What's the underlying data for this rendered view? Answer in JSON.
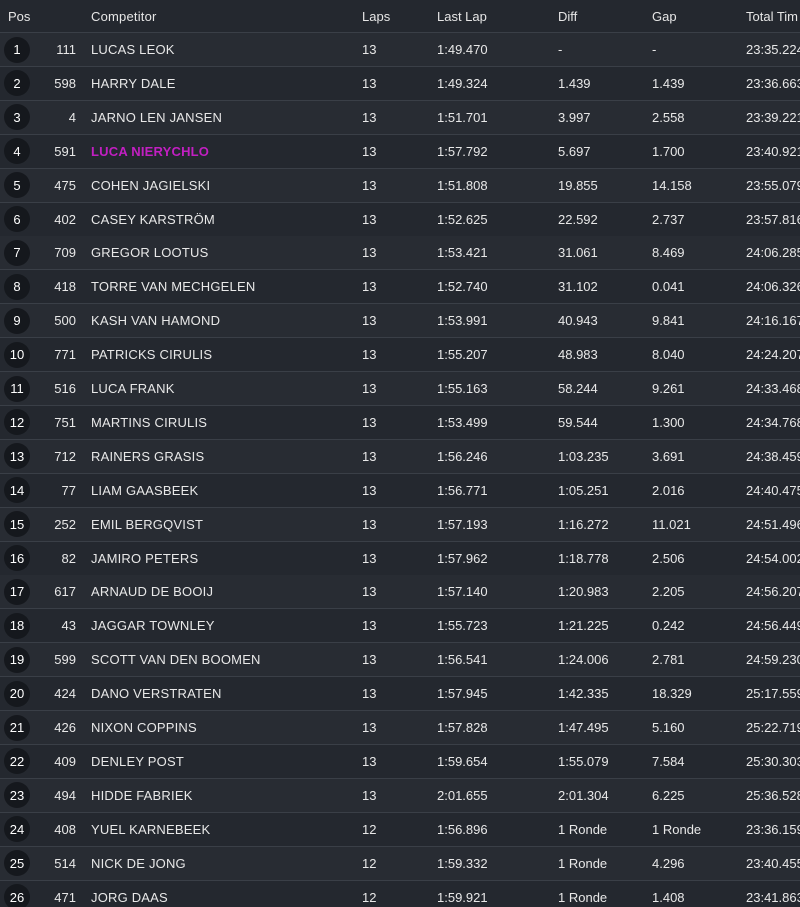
{
  "header": {
    "pos": "Pos",
    "competitor": "Competitor",
    "laps": "Laps",
    "last_lap": "Last Lap",
    "diff": "Diff",
    "gap": "Gap",
    "total_time": "Total Tim"
  },
  "colors": {
    "background": "#24282f",
    "row_alt": "#282c33",
    "highlight_name": "#c21fc2",
    "position_circle": "#15181d"
  },
  "rows": [
    {
      "pos": "1",
      "number": "111",
      "name": "LUCAS LEOK",
      "laps": "13",
      "last_lap": "1:49.470",
      "diff": "-",
      "gap": "-",
      "total": "23:35.224"
    },
    {
      "pos": "2",
      "number": "598",
      "name": "HARRY DALE",
      "laps": "13",
      "last_lap": "1:49.324",
      "diff": "1.439",
      "gap": "1.439",
      "total": "23:36.663"
    },
    {
      "pos": "3",
      "number": "4",
      "name": "JARNO LEN JANSEN",
      "laps": "13",
      "last_lap": "1:51.701",
      "diff": "3.997",
      "gap": "2.558",
      "total": "23:39.221"
    },
    {
      "pos": "4",
      "number": "591",
      "name": "LUCA NIERYCHLO",
      "laps": "13",
      "last_lap": "1:57.792",
      "diff": "5.697",
      "gap": "1.700",
      "total": "23:40.921",
      "highlight": true
    },
    {
      "pos": "5",
      "number": "475",
      "name": "COHEN JAGIELSKI",
      "laps": "13",
      "last_lap": "1:51.808",
      "diff": "19.855",
      "gap": "14.158",
      "total": "23:55.079"
    },
    {
      "pos": "6",
      "number": "402",
      "name": "CASEY KARSTRÖM",
      "laps": "13",
      "last_lap": "1:52.625",
      "diff": "22.592",
      "gap": "2.737",
      "total": "23:57.816"
    },
    {
      "pos": "7",
      "number": "709",
      "name": "GREGOR LOOTUS",
      "laps": "13",
      "last_lap": "1:53.421",
      "diff": "31.061",
      "gap": "8.469",
      "total": "24:06.285"
    },
    {
      "pos": "8",
      "number": "418",
      "name": "TORRE VAN MECHGELEN",
      "laps": "13",
      "last_lap": "1:52.740",
      "diff": "31.102",
      "gap": "0.041",
      "total": "24:06.326"
    },
    {
      "pos": "9",
      "number": "500",
      "name": "KASH VAN HAMOND",
      "laps": "13",
      "last_lap": "1:53.991",
      "diff": "40.943",
      "gap": "9.841",
      "total": "24:16.167"
    },
    {
      "pos": "10",
      "number": "771",
      "name": "PATRICKS CIRULIS",
      "laps": "13",
      "last_lap": "1:55.207",
      "diff": "48.983",
      "gap": "8.040",
      "total": "24:24.207"
    },
    {
      "pos": "11",
      "number": "516",
      "name": "LUCA FRANK",
      "laps": "13",
      "last_lap": "1:55.163",
      "diff": "58.244",
      "gap": "9.261",
      "total": "24:33.468"
    },
    {
      "pos": "12",
      "number": "751",
      "name": "MARTINS CIRULIS",
      "laps": "13",
      "last_lap": "1:53.499",
      "diff": "59.544",
      "gap": "1.300",
      "total": "24:34.768"
    },
    {
      "pos": "13",
      "number": "712",
      "name": "RAINERS GRASIS",
      "laps": "13",
      "last_lap": "1:56.246",
      "diff": "1:03.235",
      "gap": "3.691",
      "total": "24:38.459"
    },
    {
      "pos": "14",
      "number": "77",
      "name": "LIAM GAASBEEK",
      "laps": "13",
      "last_lap": "1:56.771",
      "diff": "1:05.251",
      "gap": "2.016",
      "total": "24:40.475"
    },
    {
      "pos": "15",
      "number": "252",
      "name": "EMIL BERGQVIST",
      "laps": "13",
      "last_lap": "1:57.193",
      "diff": "1:16.272",
      "gap": "11.021",
      "total": "24:51.496"
    },
    {
      "pos": "16",
      "number": "82",
      "name": "JAMIRO PETERS",
      "laps": "13",
      "last_lap": "1:57.962",
      "diff": "1:18.778",
      "gap": "2.506",
      "total": "24:54.002"
    },
    {
      "pos": "17",
      "number": "617",
      "name": "ARNAUD DE BOOIJ",
      "laps": "13",
      "last_lap": "1:57.140",
      "diff": "1:20.983",
      "gap": "2.205",
      "total": "24:56.207"
    },
    {
      "pos": "18",
      "number": "43",
      "name": "JAGGAR TOWNLEY",
      "laps": "13",
      "last_lap": "1:55.723",
      "diff": "1:21.225",
      "gap": "0.242",
      "total": "24:56.449"
    },
    {
      "pos": "19",
      "number": "599",
      "name": "SCOTT VAN DEN BOOMEN",
      "laps": "13",
      "last_lap": "1:56.541",
      "diff": "1:24.006",
      "gap": "2.781",
      "total": "24:59.230"
    },
    {
      "pos": "20",
      "number": "424",
      "name": "DANO VERSTRATEN",
      "laps": "13",
      "last_lap": "1:57.945",
      "diff": "1:42.335",
      "gap": "18.329",
      "total": "25:17.559"
    },
    {
      "pos": "21",
      "number": "426",
      "name": "NIXON COPPINS",
      "laps": "13",
      "last_lap": "1:57.828",
      "diff": "1:47.495",
      "gap": "5.160",
      "total": "25:22.719"
    },
    {
      "pos": "22",
      "number": "409",
      "name": "DENLEY POST",
      "laps": "13",
      "last_lap": "1:59.654",
      "diff": "1:55.079",
      "gap": "7.584",
      "total": "25:30.303"
    },
    {
      "pos": "23",
      "number": "494",
      "name": "HIDDE FABRIEK",
      "laps": "13",
      "last_lap": "2:01.655",
      "diff": "2:01.304",
      "gap": "6.225",
      "total": "25:36.528"
    },
    {
      "pos": "24",
      "number": "408",
      "name": "YUEL KARNEBEEK",
      "laps": "12",
      "last_lap": "1:56.896",
      "diff": "1 Ronde",
      "gap": "1 Ronde",
      "total": "23:36.159"
    },
    {
      "pos": "25",
      "number": "514",
      "name": "NICK DE JONG",
      "laps": "12",
      "last_lap": "1:59.332",
      "diff": "1 Ronde",
      "gap": "4.296",
      "total": "23:40.455"
    },
    {
      "pos": "26",
      "number": "471",
      "name": "JORG DAAS",
      "laps": "12",
      "last_lap": "1:59.921",
      "diff": "1 Ronde",
      "gap": "1.408",
      "total": "23:41.863"
    }
  ]
}
